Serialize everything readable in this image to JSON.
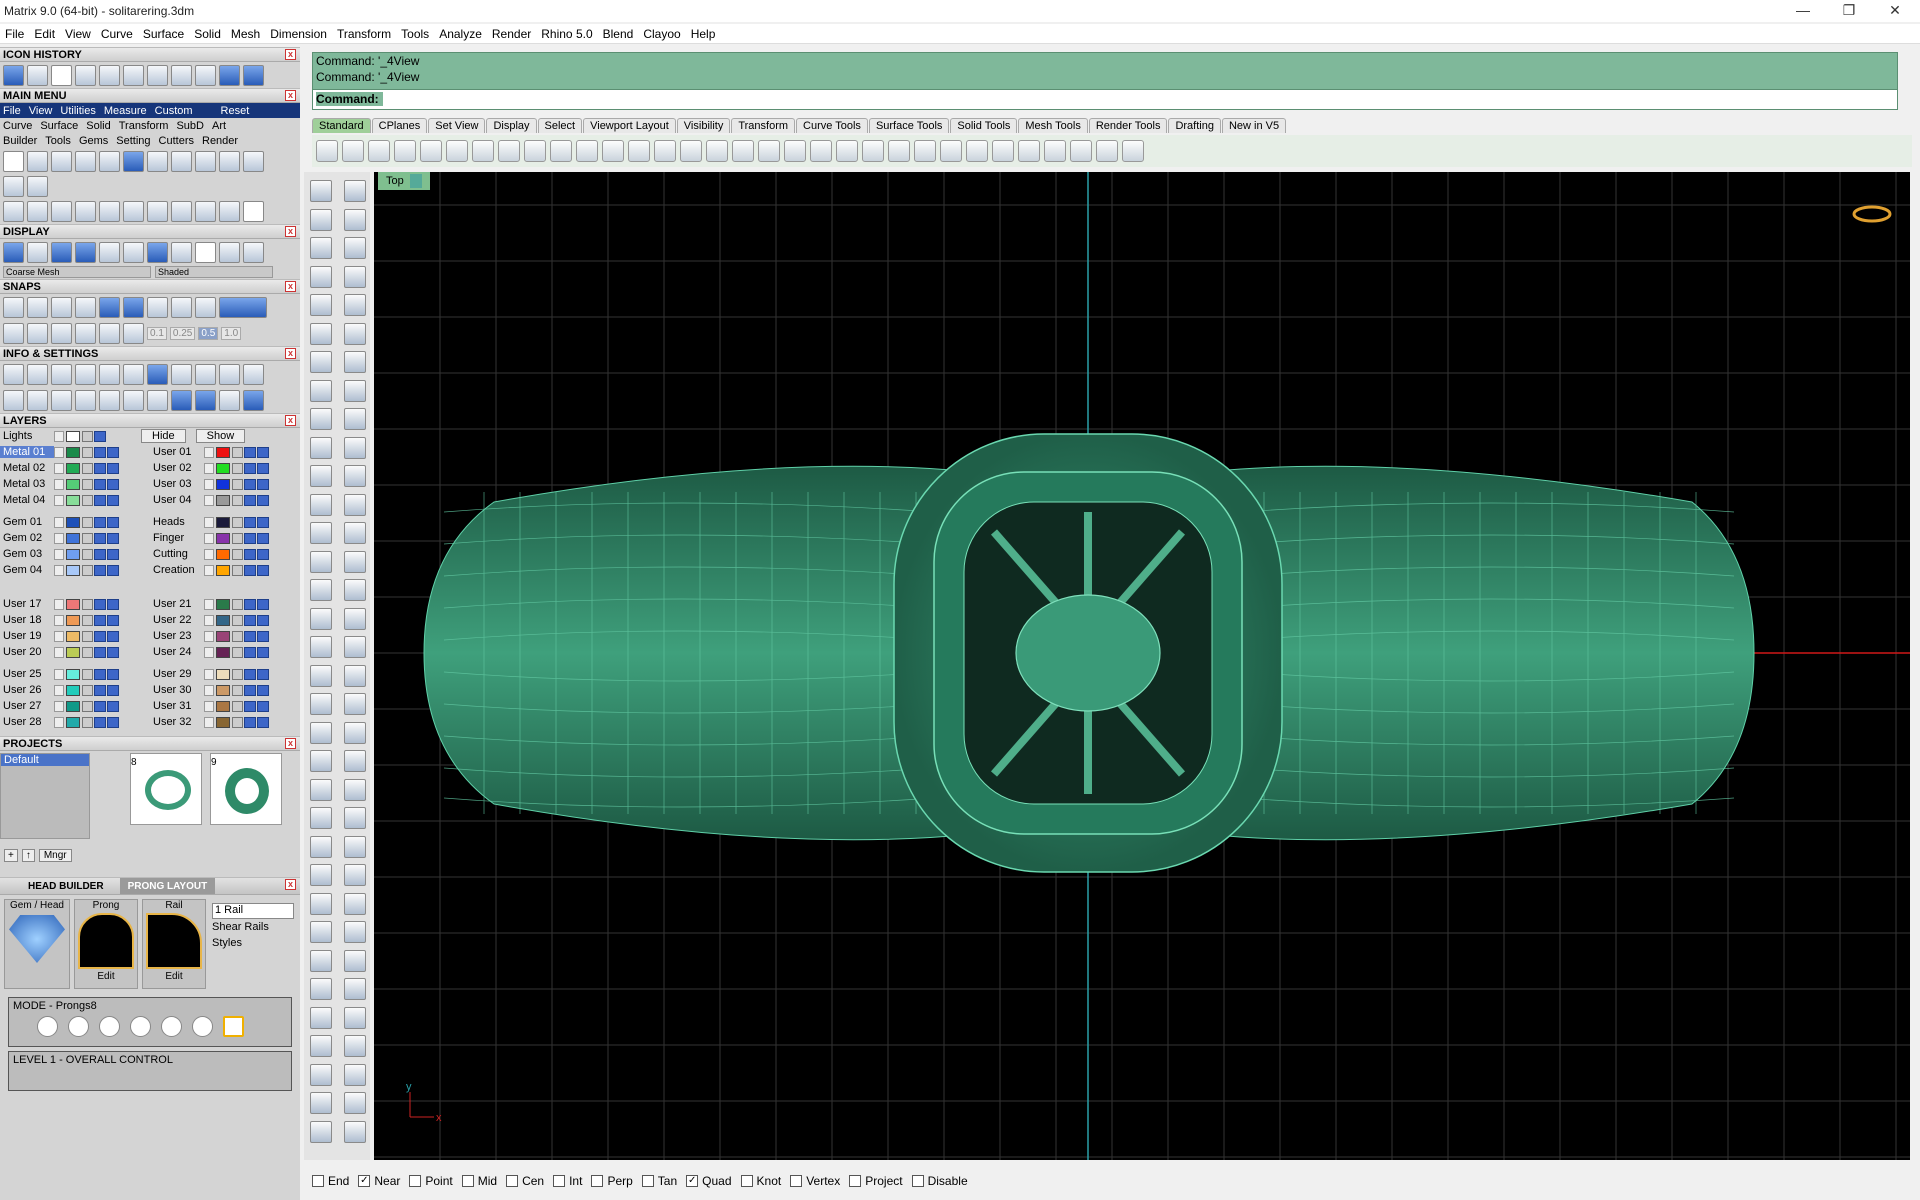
{
  "window": {
    "title": "Matrix 9.0 (64-bit) - solitarering.3dm",
    "minimize": "—",
    "maximize": "❐",
    "close": "✕"
  },
  "menu": [
    "File",
    "Edit",
    "View",
    "Curve",
    "Surface",
    "Solid",
    "Mesh",
    "Dimension",
    "Transform",
    "Tools",
    "Analyze",
    "Render",
    "Rhino 5.0",
    "Blend",
    "Clayoo",
    "Help"
  ],
  "panels": {
    "icon_history": "ICON HISTORY",
    "main_menu": "MAIN MENU",
    "main_menu_row1": [
      "File",
      "View",
      "Utilities",
      "Measure",
      "Custom",
      "Reset"
    ],
    "main_menu_row2": [
      "Curve",
      "Surface",
      "Solid",
      "Transform",
      "SubD",
      "Art"
    ],
    "main_menu_row3": [
      "Builder",
      "Tools",
      "Gems",
      "Setting",
      "Cutters",
      "Render"
    ],
    "display": "DISPLAY",
    "display_mesh": "Coarse Mesh",
    "display_mode": "Shaded",
    "snaps": "SNAPS",
    "snap_values": [
      "0.1",
      "0.25",
      "0.5",
      "1.0"
    ],
    "info": "INFO & SETTINGS",
    "layers": "LAYERS",
    "projects": "PROJECTS",
    "project_default": "Default",
    "project_thumbs": [
      "8",
      "9"
    ],
    "project_mngr": "Mngr",
    "head_builder": "HEAD  BUILDER",
    "prong_layout": "PRONG LAYOUT",
    "gem_head": "Gem / Head",
    "prong": "Prong",
    "rail": "Rail",
    "edit": "Edit",
    "rail_count": "1 Rail",
    "shear_rails": "Shear Rails",
    "styles": "Styles",
    "mode": "MODE - Prongs8",
    "level": "LEVEL 1 - OVERALL CONTROL"
  },
  "layers": {
    "lights": "Lights",
    "hide": "Hide",
    "show": "Show",
    "rows": [
      {
        "l": "Metal 01",
        "lc": "#1a8a4a",
        "r": "User 01",
        "rc": "#ee1111",
        "sel": true
      },
      {
        "l": "Metal 02",
        "lc": "#22aa55",
        "r": "User 02",
        "rc": "#22dd22"
      },
      {
        "l": "Metal 03",
        "lc": "#55cc77",
        "r": "User 03",
        "rc": "#1133dd"
      },
      {
        "l": "Metal 04",
        "lc": "#88dd99",
        "r": "User 04",
        "rc": "#999999"
      },
      {
        "l": "Gem 01",
        "lc": "#1e50b8",
        "r": "Heads",
        "rc": "#1a1a3a"
      },
      {
        "l": "Gem 02",
        "lc": "#3f73d8",
        "r": "Finger",
        "rc": "#8833aa"
      },
      {
        "l": "Gem 03",
        "lc": "#6f9ef0",
        "r": "Cutting",
        "rc": "#ff6a00"
      },
      {
        "l": "Gem 04",
        "lc": "#a8c8f8",
        "r": "Creation",
        "rc": "#ffa500"
      },
      {
        "l": "User 17",
        "lc": "#ee7777",
        "r": "User 21",
        "rc": "#2a7a4a"
      },
      {
        "l": "User 18",
        "lc": "#ee9955",
        "r": "User 22",
        "rc": "#336688"
      },
      {
        "l": "User 19",
        "lc": "#eebb66",
        "r": "User 23",
        "rc": "#994477"
      },
      {
        "l": "User 20",
        "lc": "#bbcc55",
        "r": "User 24",
        "rc": "#662255"
      },
      {
        "l": "User 25",
        "lc": "#66eedd",
        "r": "User 29",
        "rc": "#eeddbb"
      },
      {
        "l": "User 26",
        "lc": "#22ccbb",
        "r": "User 30",
        "rc": "#cc9966"
      },
      {
        "l": "User 27",
        "lc": "#119988",
        "r": "User 31",
        "rc": "#aa7744"
      },
      {
        "l": "User 28",
        "lc": "#22aaaa",
        "r": "User 32",
        "rc": "#886633"
      }
    ]
  },
  "command": {
    "line1": "Command: '_4View",
    "line2": "Command: '_4View",
    "prompt": "Command:"
  },
  "tabs": [
    "Standard",
    "CPlanes",
    "Set View",
    "Display",
    "Select",
    "Viewport Layout",
    "Visibility",
    "Transform",
    "Curve Tools",
    "Surface Tools",
    "Solid Tools",
    "Mesh Tools",
    "Render Tools",
    "Drafting",
    "New in V5"
  ],
  "viewport": {
    "name": "Top",
    "axis_y": "y",
    "axis_x": "x"
  },
  "osnaps": [
    {
      "n": "End",
      "c": false
    },
    {
      "n": "Near",
      "c": true
    },
    {
      "n": "Point",
      "c": false
    },
    {
      "n": "Mid",
      "c": false
    },
    {
      "n": "Cen",
      "c": false
    },
    {
      "n": "Int",
      "c": false
    },
    {
      "n": "Perp",
      "c": false
    },
    {
      "n": "Tan",
      "c": false
    },
    {
      "n": "Quad",
      "c": true
    },
    {
      "n": "Knot",
      "c": false
    },
    {
      "n": "Vertex",
      "c": false
    },
    {
      "n": "Project",
      "c": false
    },
    {
      "n": "Disable",
      "c": false
    }
  ],
  "colors": {
    "viewport_bg": "#000000",
    "ring": "#3b9a78",
    "ring_edge": "#5fd0a8",
    "grid": "#3a3a3a",
    "command_bg": "#7fb89a",
    "layers_blue": "#3d66c8"
  }
}
